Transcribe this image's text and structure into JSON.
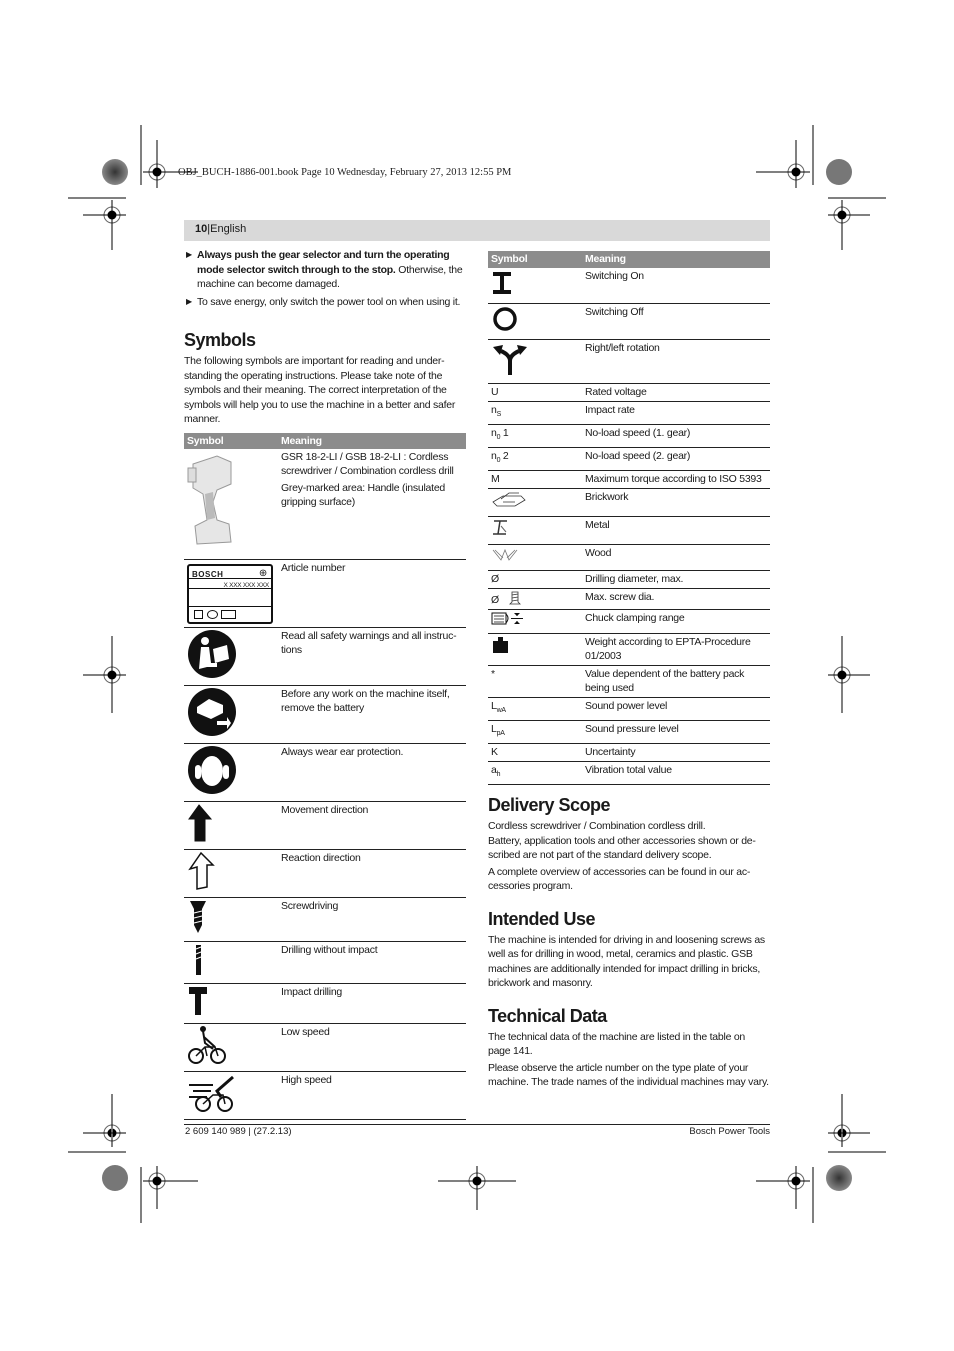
{
  "slug": "OBJ_BUCH-1886-001.book  Page 10  Wednesday, February 27, 2013  12:55 PM",
  "header": {
    "page_number": "10",
    "separator": "|",
    "language": "English"
  },
  "intro_bullets": [
    {
      "bold": "Always push the gear selector and turn the operating mode selector switch through to the stop.",
      "text": " Otherwise, the machine can become damaged."
    },
    {
      "bold": "",
      "text": "To save energy, only switch the power tool on when using it."
    }
  ],
  "symbols_section": {
    "title": "Symbols",
    "intro": "The following symbols are important for reading and under-standing the operating instructions. Please take note of the symbols and their meaning. The correct interpretation of the symbols will help you to use the machine in a better and safer manner."
  },
  "table_headers": {
    "symbol": "Symbol",
    "meaning": "Meaning"
  },
  "left_table": [
    {
      "icon": "cordless-drill-icon",
      "meaning": "GSR 18-2-LI / GSB 18-2-LI : Cordless screwdriver / Combination cordless drill",
      "meaning2": "Grey-marked area: Handle (insulated gripping surface)"
    },
    {
      "icon": "type-plate-icon",
      "plate_brand": "BOSCH",
      "plate_number": "X XXX XXX XXX",
      "meaning": "Article number"
    },
    {
      "icon": "read-manual-icon",
      "meaning": "Read all safety warnings and all instruc-tions"
    },
    {
      "icon": "remove-battery-icon",
      "meaning": "Before any work on the machine itself, remove the battery"
    },
    {
      "icon": "ear-protection-icon",
      "meaning": "Always wear ear protection."
    },
    {
      "icon": "movement-direction-icon",
      "meaning": "Movement direction"
    },
    {
      "icon": "reaction-direction-icon",
      "meaning": "Reaction direction"
    },
    {
      "icon": "screwdriving-icon",
      "meaning": "Screwdriving"
    },
    {
      "icon": "drilling-icon",
      "meaning": "Drilling without impact"
    },
    {
      "icon": "impact-drilling-icon",
      "meaning": "Impact drilling"
    },
    {
      "icon": "low-speed-icon",
      "meaning": "Low speed"
    },
    {
      "icon": "high-speed-icon",
      "meaning": "High speed"
    }
  ],
  "right_table": [
    {
      "icon": "switch-on-icon",
      "symbol": "",
      "meaning": "Switching On"
    },
    {
      "icon": "switch-off-icon",
      "symbol": "",
      "meaning": "Switching Off"
    },
    {
      "icon": "rotation-icon",
      "symbol": "",
      "meaning": "Right/left rotation"
    },
    {
      "symbol": "U",
      "meaning": "Rated voltage"
    },
    {
      "symbol": "n",
      "sub": "S",
      "meaning": "Impact rate"
    },
    {
      "symbol": "n",
      "sub": "0",
      "suffix": " 1",
      "meaning": "No-load speed (1. gear)"
    },
    {
      "symbol": "n",
      "sub": "0",
      "suffix": " 2",
      "meaning": "No-load speed (2. gear)"
    },
    {
      "symbol": "M",
      "meaning": "Maximum torque according to ISO 5393"
    },
    {
      "icon": "brickwork-icon",
      "symbol": "",
      "meaning": "Brickwork"
    },
    {
      "icon": "metal-icon",
      "symbol": "",
      "meaning": "Metal"
    },
    {
      "icon": "wood-icon",
      "symbol": "",
      "meaning": "Wood"
    },
    {
      "symbol": "Ø",
      "meaning": "Drilling diameter, max."
    },
    {
      "symbol": "Ø",
      "icon": "screw-icon",
      "meaning": "Max. screw dia."
    },
    {
      "icon": "chuck-icon",
      "symbol": "",
      "meaning": "Chuck clamping range"
    },
    {
      "icon": "weight-icon",
      "symbol": "",
      "meaning": "Weight according to EPTA-Procedure 01/2003"
    },
    {
      "symbol": "*",
      "meaning": "Value dependent of the battery pack being used"
    },
    {
      "symbol": "L",
      "sub": "wA",
      "meaning": "Sound power level"
    },
    {
      "symbol": "L",
      "sub": "pA",
      "meaning": "Sound pressure level"
    },
    {
      "symbol": "K",
      "meaning": "Uncertainty"
    },
    {
      "symbol": "a",
      "sub": "h",
      "meaning": "Vibration total value"
    }
  ],
  "delivery_scope": {
    "title": "Delivery Scope",
    "p1": "Cordless screwdriver / Combination cordless drill.",
    "p2": "Battery, application tools and other accessories shown or de-scribed are not part of the standard delivery scope.",
    "p3": "A complete overview of accessories can be found in our ac-cessories program."
  },
  "intended_use": {
    "title": "Intended Use",
    "p1": "The machine is intended for driving in and loosening screws as well as for drilling in wood, metal, ceramics and plastic. GSB machines are additionally intended for impact drilling in bricks, brickwork and masonry."
  },
  "technical_data": {
    "title": "Technical Data",
    "p1": "The technical data of the machine are listed in the table on page 141.",
    "p2": "Please observe the article number on the type plate of your machine. The trade names of the individual machines may vary."
  },
  "footer": {
    "left": "2 609 140 989 | (27.2.13)",
    "right": "Bosch Power Tools"
  }
}
